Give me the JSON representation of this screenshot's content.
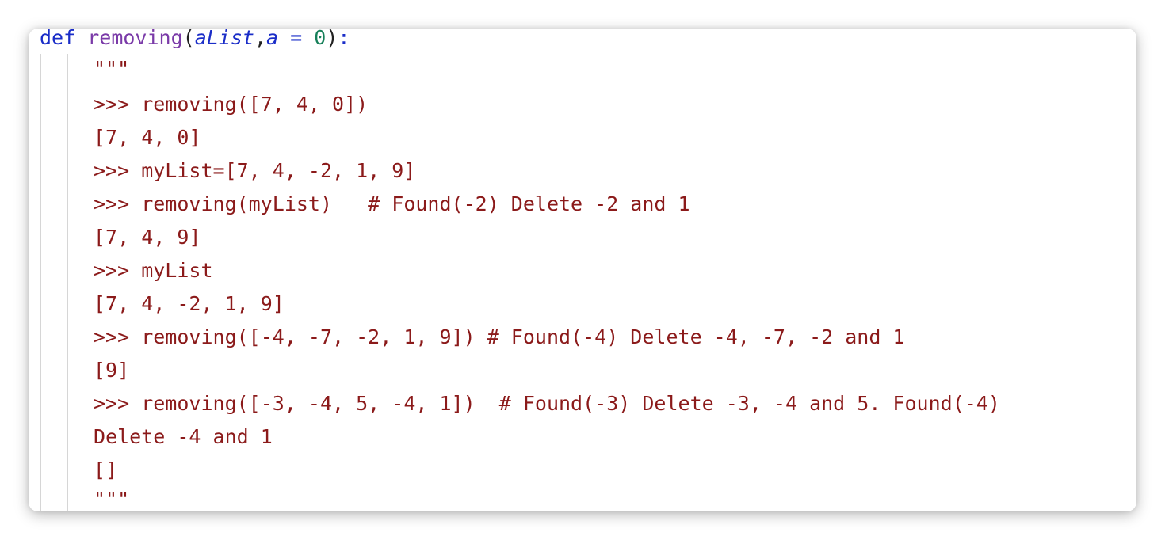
{
  "def_line": {
    "keyword": "def",
    "function_name": "removing",
    "open_paren": "(",
    "param1": "aList",
    "comma": ",",
    "param2": "a",
    "equals": " = ",
    "default_value": "0",
    "close": ")",
    "colon": ":"
  },
  "docstring_lines": [
    "\"\"\"",
    "",
    ">>> removing([7, 4, 0])",
    "[7, 4, 0]",
    ">>> myList=[7, 4, -2, 1, 9]",
    ">>> removing(myList)   # Found(-2) Delete -2 and 1",
    "[7, 4, 9]",
    ">>> myList",
    "[7, 4, -2, 1, 9]",
    ">>> removing([-4, -7, -2, 1, 9]) # Found(-4) Delete -4, -7, -2 and 1",
    "[9]",
    ">>> removing([-3, -4, 5, -4, 1])  # Found(-3) Delete -3, -4 and 5. Found(-4)",
    "Delete -4 and 1",
    "[]",
    "\"\"\""
  ],
  "colors": {
    "keyword": "#1a2dc8",
    "function_name": "#7a3aa8",
    "number": "#17805a",
    "string": "#8b1a1a"
  }
}
